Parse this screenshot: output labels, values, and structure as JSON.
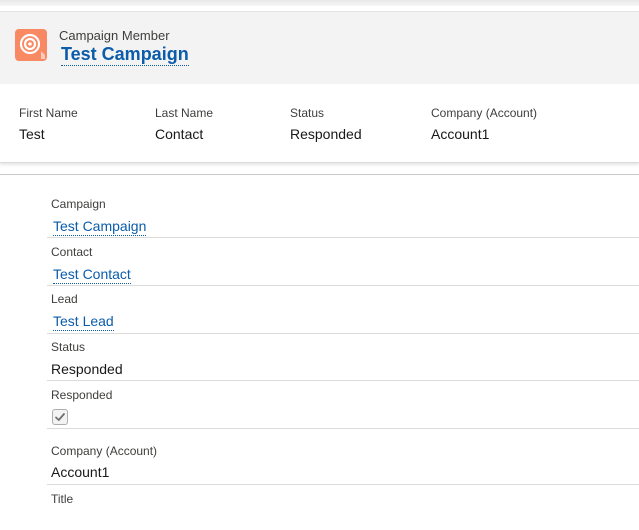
{
  "header": {
    "entity_label": "Campaign Member",
    "record_title": "Test Campaign",
    "icon": "campaign-target-icon",
    "icon_color": "#f88962"
  },
  "highlights": [
    {
      "label": "First Name",
      "value": "Test"
    },
    {
      "label": "Last Name",
      "value": "Contact"
    },
    {
      "label": "Status",
      "value": "Responded"
    },
    {
      "label": "Company (Account)",
      "value": "Account1"
    }
  ],
  "details": {
    "campaign": {
      "label": "Campaign",
      "value": "Test Campaign"
    },
    "contact": {
      "label": "Contact",
      "value": "Test Contact"
    },
    "lead": {
      "label": "Lead",
      "value": "Test Lead"
    },
    "status": {
      "label": "Status",
      "value": "Responded"
    },
    "responded": {
      "label": "Responded",
      "checked": true
    },
    "company": {
      "label": "Company (Account)",
      "value": "Account1"
    },
    "title": {
      "label": "Title",
      "value": ""
    }
  },
  "colors": {
    "link": "#0b5cab",
    "header_bg": "#f3f3f3"
  }
}
